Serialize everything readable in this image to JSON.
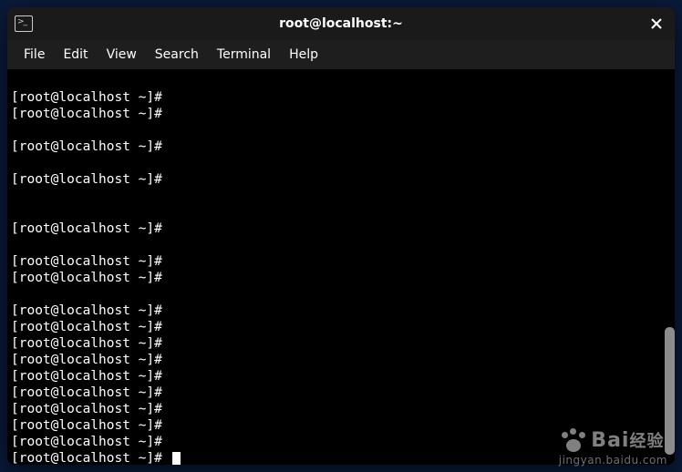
{
  "window": {
    "title": "root@localhost:~"
  },
  "menu": {
    "items": [
      "File",
      "Edit",
      "View",
      "Search",
      "Terminal",
      "Help"
    ]
  },
  "terminal": {
    "prompt": "[root@localhost ~]#",
    "lines": [
      {
        "type": "blank"
      },
      {
        "type": "prompt"
      },
      {
        "type": "prompt"
      },
      {
        "type": "blank"
      },
      {
        "type": "prompt"
      },
      {
        "type": "blank"
      },
      {
        "type": "prompt"
      },
      {
        "type": "blank"
      },
      {
        "type": "blank"
      },
      {
        "type": "prompt"
      },
      {
        "type": "blank"
      },
      {
        "type": "prompt"
      },
      {
        "type": "prompt"
      },
      {
        "type": "blank"
      },
      {
        "type": "prompt"
      },
      {
        "type": "prompt"
      },
      {
        "type": "prompt"
      },
      {
        "type": "prompt"
      },
      {
        "type": "prompt"
      },
      {
        "type": "prompt"
      },
      {
        "type": "prompt"
      },
      {
        "type": "prompt"
      },
      {
        "type": "prompt"
      },
      {
        "type": "prompt",
        "cursor": true
      }
    ]
  },
  "watermark": {
    "brand": "Bai",
    "brand_suffix": "经验",
    "url": "jingyan.baidu.com"
  }
}
